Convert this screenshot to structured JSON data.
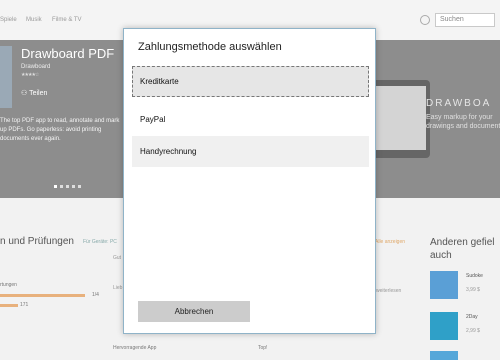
{
  "store": {
    "nav": [
      "Spiele",
      "Musik",
      "Filme & TV"
    ],
    "search_placeholder": "Suchen",
    "app": {
      "title": "Drawboard PDF",
      "publisher": "Drawboard",
      "share_label": "Teilen",
      "description": "The top PDF app to read, annotate and mark up PDFs. Go paperless: avoid printing documents ever again."
    },
    "promo": {
      "logo": "DRAWBOA",
      "tagline": "Easy markup for your drawings and documents"
    },
    "reviews": {
      "title": "n und Prüfungen",
      "meta": "Für Geräte: PC",
      "rating_label": "rtungen",
      "bar1_value": "1/4",
      "bar2_value": "171",
      "hint": "Alle anzeigen",
      "text_a": "Gut",
      "text_b": "Lieb",
      "text_c": "weiterlesen",
      "bottom_left": "Hervorragende App",
      "bottom_mid": "Top!"
    },
    "others": {
      "title": "Anderen gefiel auch",
      "items": [
        {
          "name": "Sudoke",
          "price": "3,99 $"
        },
        {
          "name": "2Day",
          "price": "2,99 $"
        }
      ]
    }
  },
  "dialog": {
    "title": "Zahlungsmethode auswählen",
    "options": [
      "Kreditkarte",
      "PayPal",
      "Handyrechnung"
    ],
    "cancel_label": "Abbrechen"
  }
}
